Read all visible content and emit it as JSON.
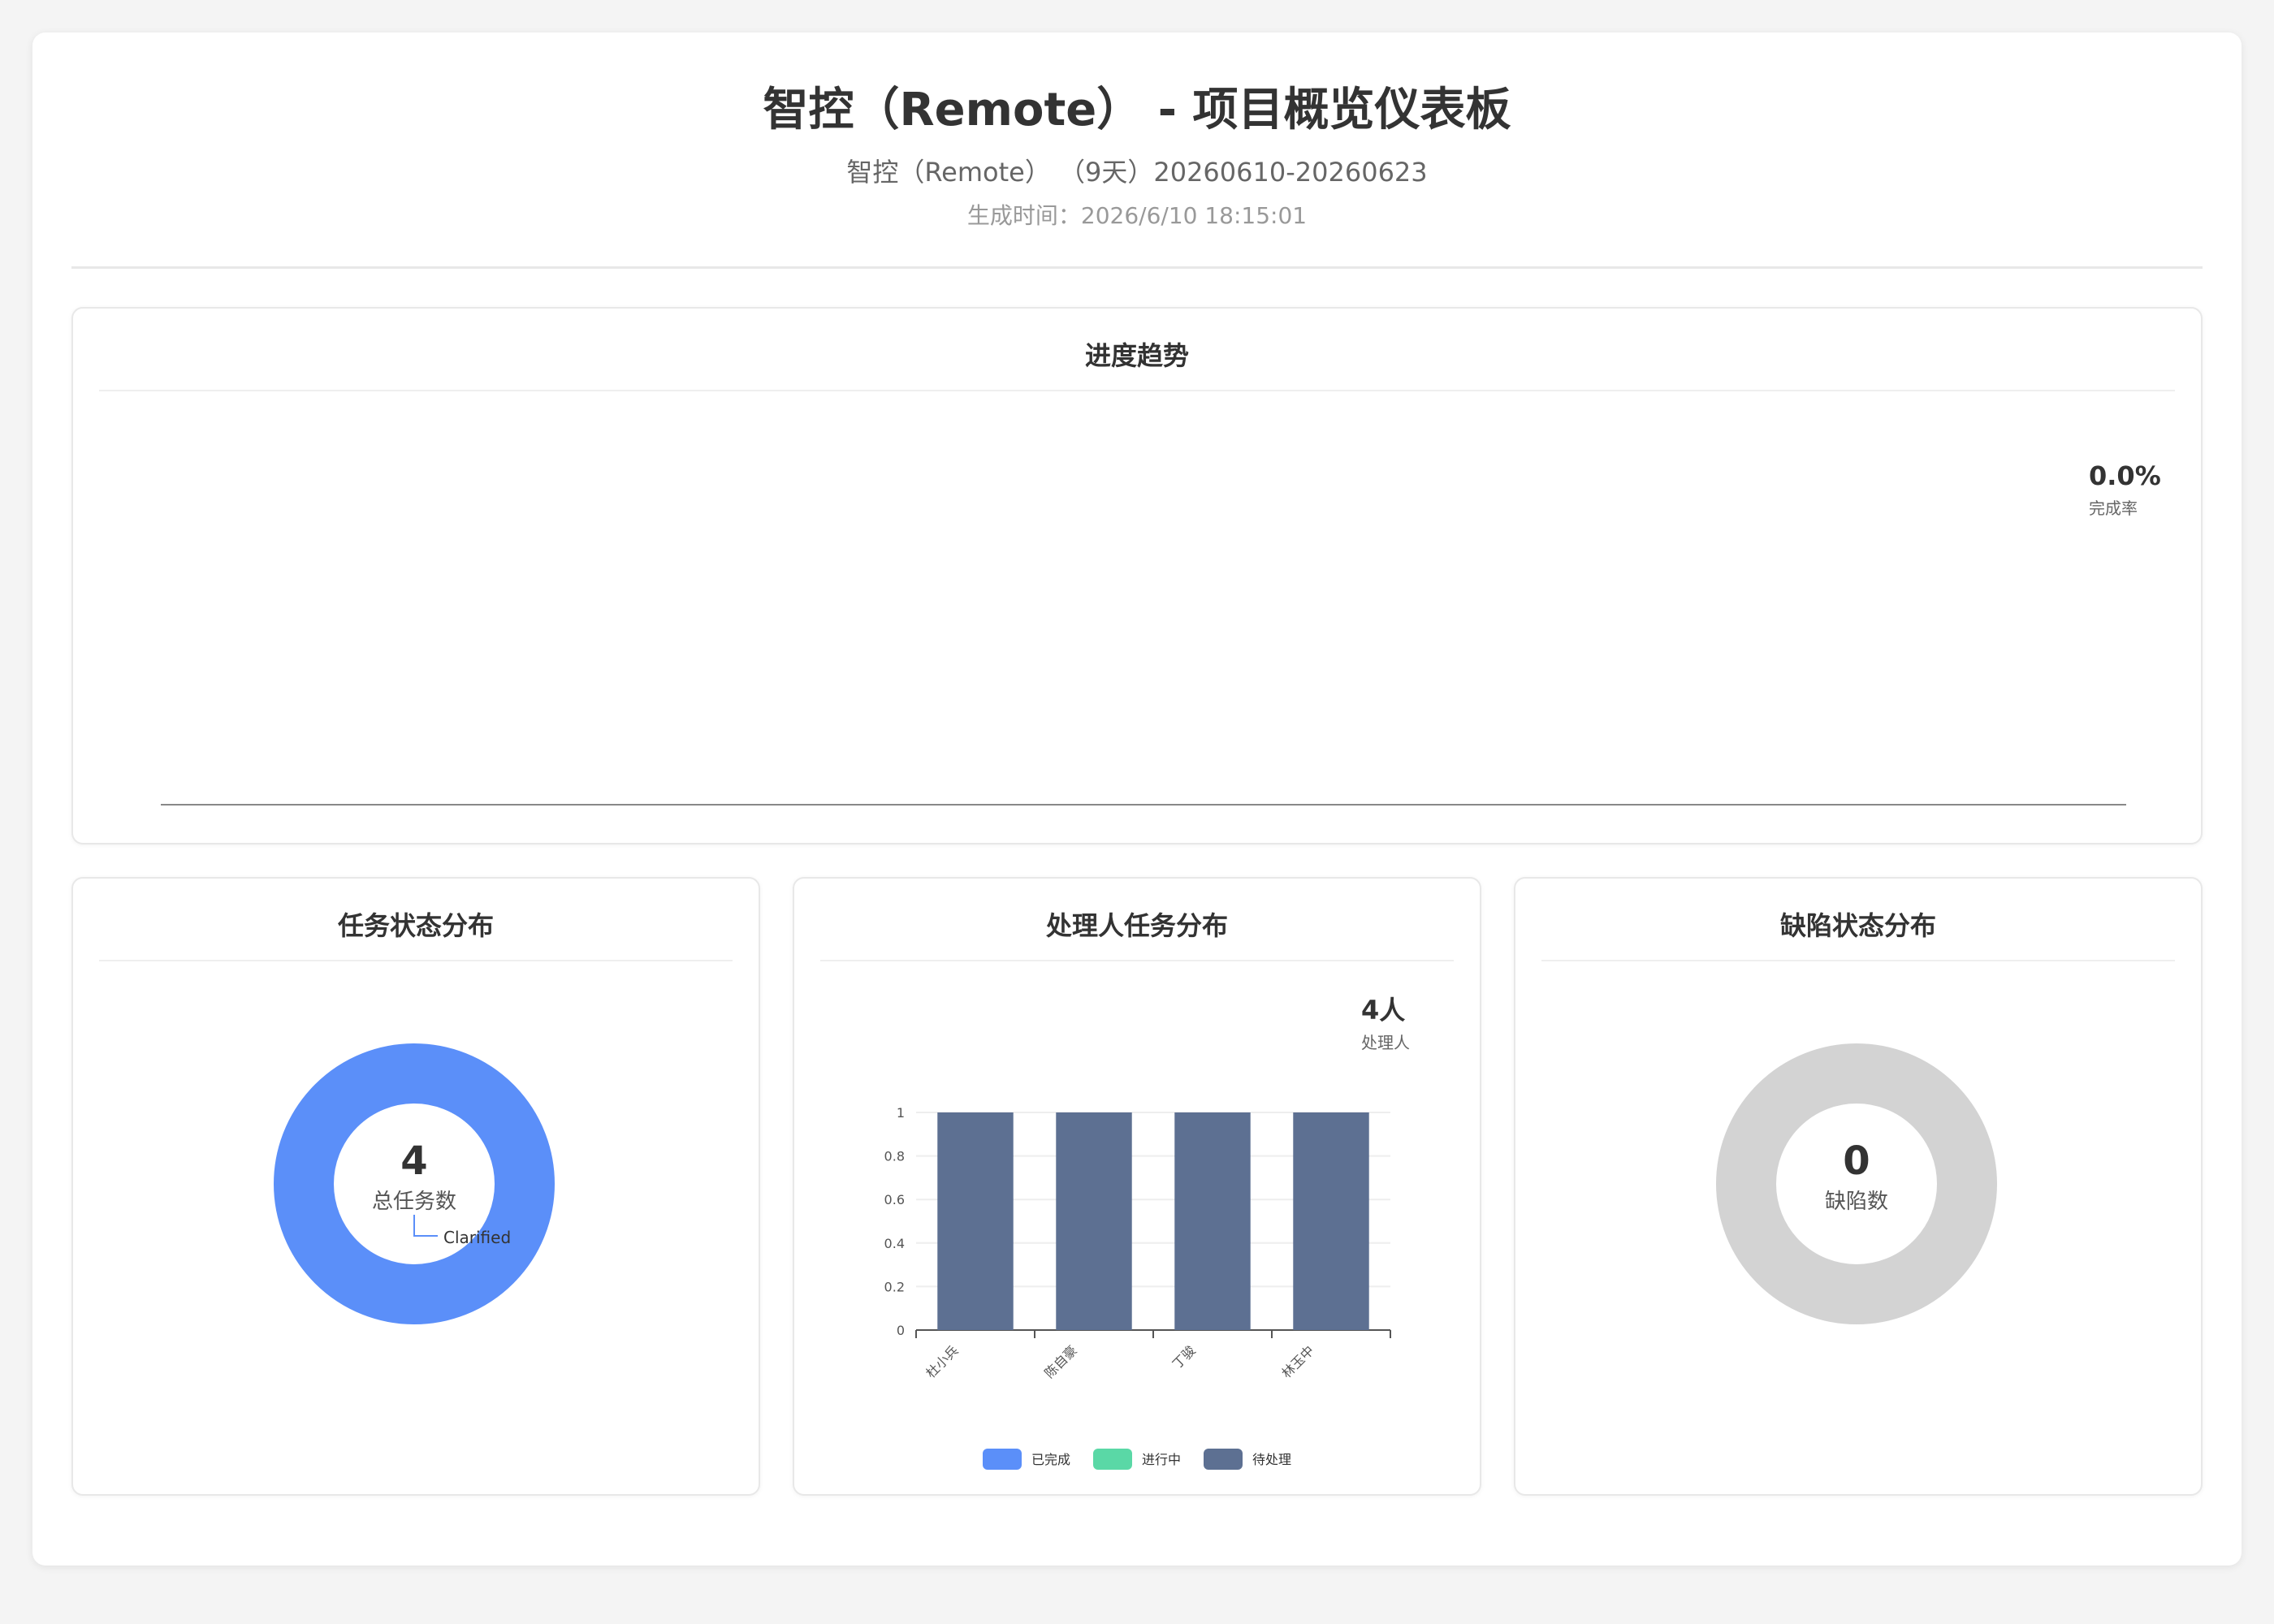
{
  "header": {
    "title": "智控（Remote） - 项目概览仪表板",
    "subtitle": "智控（Remote） （9天）20260610-20260623",
    "generated": "生成时间：2026/6/10 18:15:01"
  },
  "progress": {
    "title": "进度趋势",
    "rate_value": "0.0%",
    "rate_label": "完成率"
  },
  "task_status": {
    "title": "任务状态分布",
    "total_value": "4",
    "total_label": "总任务数",
    "color": "#5b8ff9",
    "slices": [
      {
        "name": "Clarified",
        "value": 4
      }
    ]
  },
  "assignee": {
    "title": "处理人任务分布",
    "count_value": "4人",
    "count_label": "处理人"
  },
  "defect_status": {
    "title": "缺陷状态分布",
    "total_value": "0",
    "total_label": "缺陷数",
    "color": "#d3d3d3"
  },
  "chart_data": {
    "type": "bar",
    "categories": [
      "杜小兵",
      "陈自豪",
      "丁骏",
      "林玉中"
    ],
    "series": [
      {
        "name": "已完成",
        "color": "#5b8ff9",
        "values": [
          0,
          0,
          0,
          0
        ]
      },
      {
        "name": "进行中",
        "color": "#5ad8a6",
        "values": [
          0,
          0,
          0,
          0
        ]
      },
      {
        "name": "待处理",
        "color": "#5d7092",
        "values": [
          1,
          1,
          1,
          1
        ]
      }
    ],
    "ylim": [
      0,
      1
    ],
    "yticks": [
      "0",
      "0.2",
      "0.4",
      "0.6",
      "0.8",
      "1"
    ],
    "grid": true,
    "legend": "bottom",
    "stacked": true
  }
}
